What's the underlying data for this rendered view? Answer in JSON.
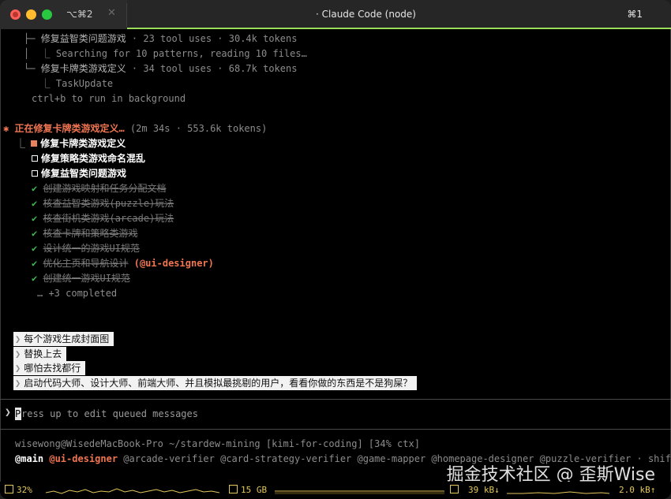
{
  "window": {
    "title": "· Claude Code (node)",
    "tab_shortcut": "⌥⌘2",
    "close_glyph": "✕",
    "right_shortcut": "⌘1"
  },
  "agents_tree": {
    "line1": {
      "prefix": "├─ ",
      "name": "修复益智类问题游戏",
      "meta": " · 23 tool uses · 30.4k tokens"
    },
    "line2": {
      "prefix": "│  ⎿ ",
      "text": "Searching for 10 patterns, reading 10 files…"
    },
    "line3": {
      "prefix": "└─ ",
      "name": "修复卡牌类游戏定义",
      "meta": " · 34 tool uses · 68.7k tokens"
    },
    "line4": {
      "prefix": "   ⎿ ",
      "text": "TaskUpdate"
    },
    "hint": "ctrl+b to run in background"
  },
  "status": {
    "star": "✱",
    "title": "正在修复卡牌类游戏定义…",
    "meta": " (2m 34s · 553.6k tokens)"
  },
  "tasks": {
    "active": {
      "branch": "⎿ ",
      "label": "修复卡牌类游戏定义"
    },
    "pending": [
      "修复策略类游戏命名混乱",
      "修复益智类问题游戏"
    ],
    "completed": [
      "创建游戏映射和任务分配文档",
      "核查益智类游戏(puzzle)玩法",
      "核查街机类游戏(arcade)玩法",
      "核查卡牌和策略类游戏",
      "设计统一的游戏UI规范",
      "优化主页和导航设计",
      "创建统一游戏UI规范"
    ],
    "completed_assignee": "(@ui-designer)",
    "more": "… +3 completed",
    "check_glyph": "✔"
  },
  "queued_messages": [
    "每个游戏生成封面图",
    "替换上去",
    "哪怕去找都行",
    "启动代码大师、设计大师、前端大师、并且模拟最挑剔的用户，看看你做的东西是不是狗屎？"
  ],
  "prompt": {
    "chevron": "❯",
    "cursor_letter": "P",
    "placeholder_rest": "ress up to edit queued messages"
  },
  "footer": {
    "path_line": "wisewong@WisedeMacBook-Pro ~/stardew-mining [kimi-for-coding] [34% ctx]",
    "agents_main": "@main",
    "agents_ui": "@ui-designer",
    "agents_rest": " @arcade-verifier @card-strategy-verifier @game-mapper @homepage-designer @puzzle-verifier · shift+↑"
  },
  "statusbar": {
    "cpu": "32%",
    "mem": "15 GB",
    "net_down": "39 kB↓",
    "net_up": "2.0 kB↑"
  },
  "watermark": "掘金技术社区 @ 歪斯Wise",
  "colors": {
    "accent_orange": "#f07552",
    "check_green": "#3fb950",
    "tab_accent": "#9bdc5a",
    "status_yellow": "#e3c85b"
  }
}
